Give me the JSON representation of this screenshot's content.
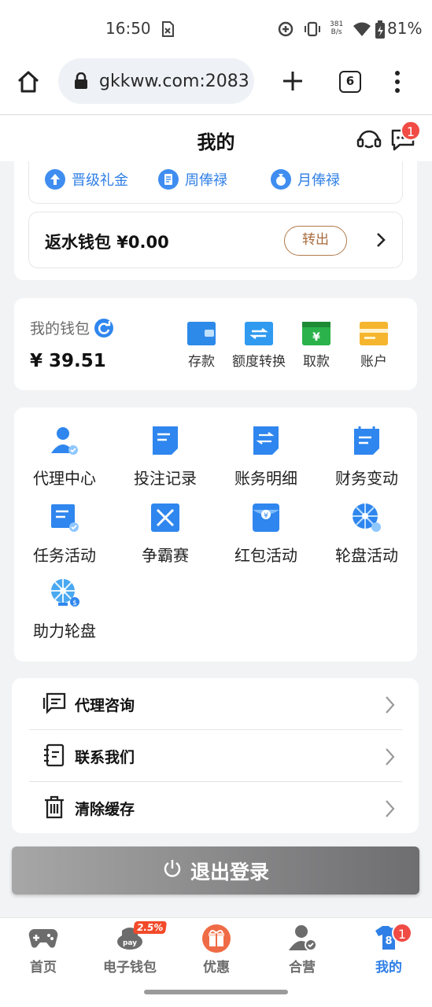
{
  "status_bar": {
    "time": "16:50",
    "net_speed_value": "381",
    "net_speed_unit": "B/s",
    "battery": "81%"
  },
  "browser": {
    "url": "gkkww.com:2083",
    "tab_count": "6"
  },
  "header": {
    "title": "我的",
    "message_badge": "1"
  },
  "vip": {
    "items": [
      "晋级礼金",
      "周俸禄",
      "月俸禄"
    ]
  },
  "rebate": {
    "label": "返水钱包 ¥0.00",
    "transfer_button": "转出"
  },
  "wallet": {
    "label": "我的钱包",
    "amount": "¥ 39.51",
    "actions": [
      "存款",
      "额度转换",
      "取款",
      "账户"
    ]
  },
  "functions": [
    "代理中心",
    "投注记录",
    "账务明细",
    "财务变动",
    "任务活动",
    "争霸赛",
    "红包活动",
    "轮盘活动",
    "助力轮盘"
  ],
  "menu": [
    "代理咨询",
    "联系我们",
    "清除缓存"
  ],
  "logout": "退出登录",
  "bottom_nav": {
    "items": [
      "首页",
      "电子钱包",
      "优惠",
      "合营",
      "我的"
    ],
    "wallet_badge": "2.5%",
    "mine_badge": "1",
    "mine_icon_number": "8"
  },
  "colors": {
    "accent": "#2f7fe6",
    "badge": "#f04b45",
    "transfer_border": "#b07a4b"
  }
}
